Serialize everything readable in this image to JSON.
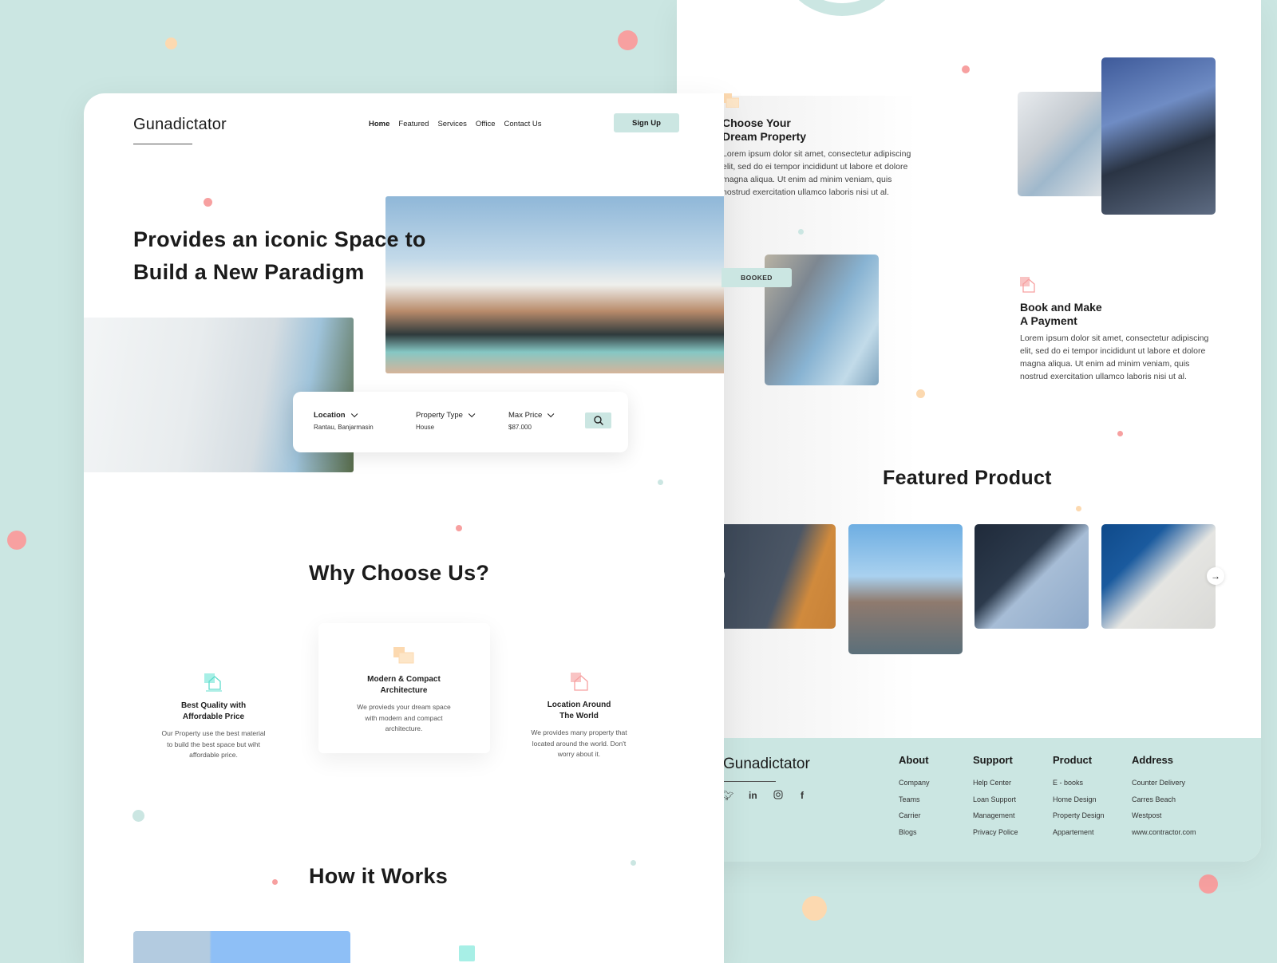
{
  "colors": {
    "bg": "#cbe6e2",
    "accent": "#cbe6e2",
    "pink": "#f7a0a0",
    "peach": "#fcd9b0",
    "teal": "#5fdccc"
  },
  "left": {
    "brand": "Gunadictator",
    "nav": [
      "Home",
      "Featured",
      "Services",
      "Office",
      "Contact Us"
    ],
    "signup": "Sign Up",
    "hero": {
      "line1": "Provides an iconic Space to",
      "line2": "Build a New Paradigm"
    },
    "search": {
      "fields": [
        {
          "label": "Location",
          "value": "Rantau, Banjarmasin"
        },
        {
          "label": "Property Type",
          "value": "House"
        },
        {
          "label": "Max Price",
          "value": "$87.000"
        }
      ],
      "button_icon": "search-icon"
    },
    "why": {
      "title": "Why Choose Us?",
      "cards": [
        {
          "icon": "house-icon",
          "title1": "Best Quality with",
          "title2": "Affordable Price",
          "d1": "Our Property use the best material",
          "d2": "to build the best space but wiht",
          "d3": "affordable price."
        },
        {
          "icon": "buildings-icon",
          "title1": "Modern &  Compact",
          "title2": "Architecture",
          "d1": "We provieds your dream space",
          "d2": "with modern and compact",
          "d3": "architecture."
        },
        {
          "icon": "house-icon",
          "title1": "Location Around",
          "title2": "The World",
          "d1": "We provides many property that",
          "d2": "located around the world. Don't",
          "d3": "worry about it."
        }
      ]
    },
    "how": {
      "title": "How it Works"
    }
  },
  "right": {
    "step1": {
      "t1": "Choose Your",
      "t2": "Dream Property",
      "l1": "Lorem ipsum dolor sit amet, consectetur adipiscing",
      "l2": "elit, sed do ei tempor incididunt ut labore et dolore",
      "l3": "magna aliqua. Ut enim ad minim veniam, quis",
      "l4": "nostrud exercitation ullamco laboris nisi ut al."
    },
    "booked": "BOOKED",
    "step2": {
      "t1": "Book and Make",
      "t2": "A Payment",
      "l1": "Lorem ipsum dolor sit amet, consectetur adipiscing",
      "l2": "elit, sed do ei tempor incididunt ut labore et dolore",
      "l3": "magna aliqua. Ut enim ad minim veniam, quis",
      "l4": "nostrud exercitation ullamco laboris nisi ut al."
    },
    "featured": {
      "title": "Featured Product"
    },
    "footer": {
      "brand": "Gunadictator",
      "social": [
        "twitter-icon",
        "linkedin-icon",
        "instagram-icon",
        "facebook-icon"
      ],
      "cols": [
        {
          "title": "About",
          "items": [
            "Company",
            "Teams",
            "Carrier",
            "Blogs"
          ]
        },
        {
          "title": "Support",
          "items": [
            "Help Center",
            "Loan Support",
            "Management",
            "Privacy Police"
          ]
        },
        {
          "title": "Product",
          "items": [
            "E - books",
            "Home Design",
            "Property Design",
            "Appartement"
          ]
        },
        {
          "title": "Address",
          "items": [
            "Counter Delivery",
            "Carres Beach",
            "Westpost",
            "www.contractor.com"
          ]
        }
      ]
    }
  }
}
